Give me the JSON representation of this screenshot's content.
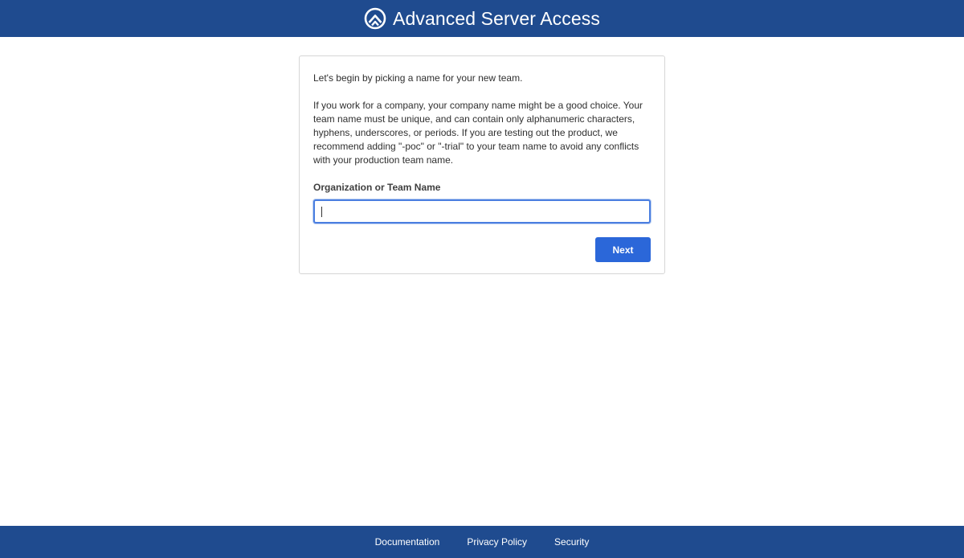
{
  "header": {
    "title": "Advanced Server Access",
    "logo_icon": "okta-asa-logo-icon",
    "background": "#1f4b8f"
  },
  "card": {
    "intro": "Let's begin by picking a name for your new team.",
    "description": "If you work for a company, your company name might be a good choice. Your team name must be unique, and can contain only alphanumeric characters, hyphens, underscores, or periods. If you are testing out the product, we recommend adding \"-poc\" or \"-trial\" to your team name to avoid any conflicts with your production team name.",
    "field_label": "Organization or Team Name",
    "field_value": "",
    "next_label": "Next",
    "button_color": "#2b67d9"
  },
  "footer": {
    "links": [
      "Documentation",
      "Privacy Policy",
      "Security"
    ]
  }
}
